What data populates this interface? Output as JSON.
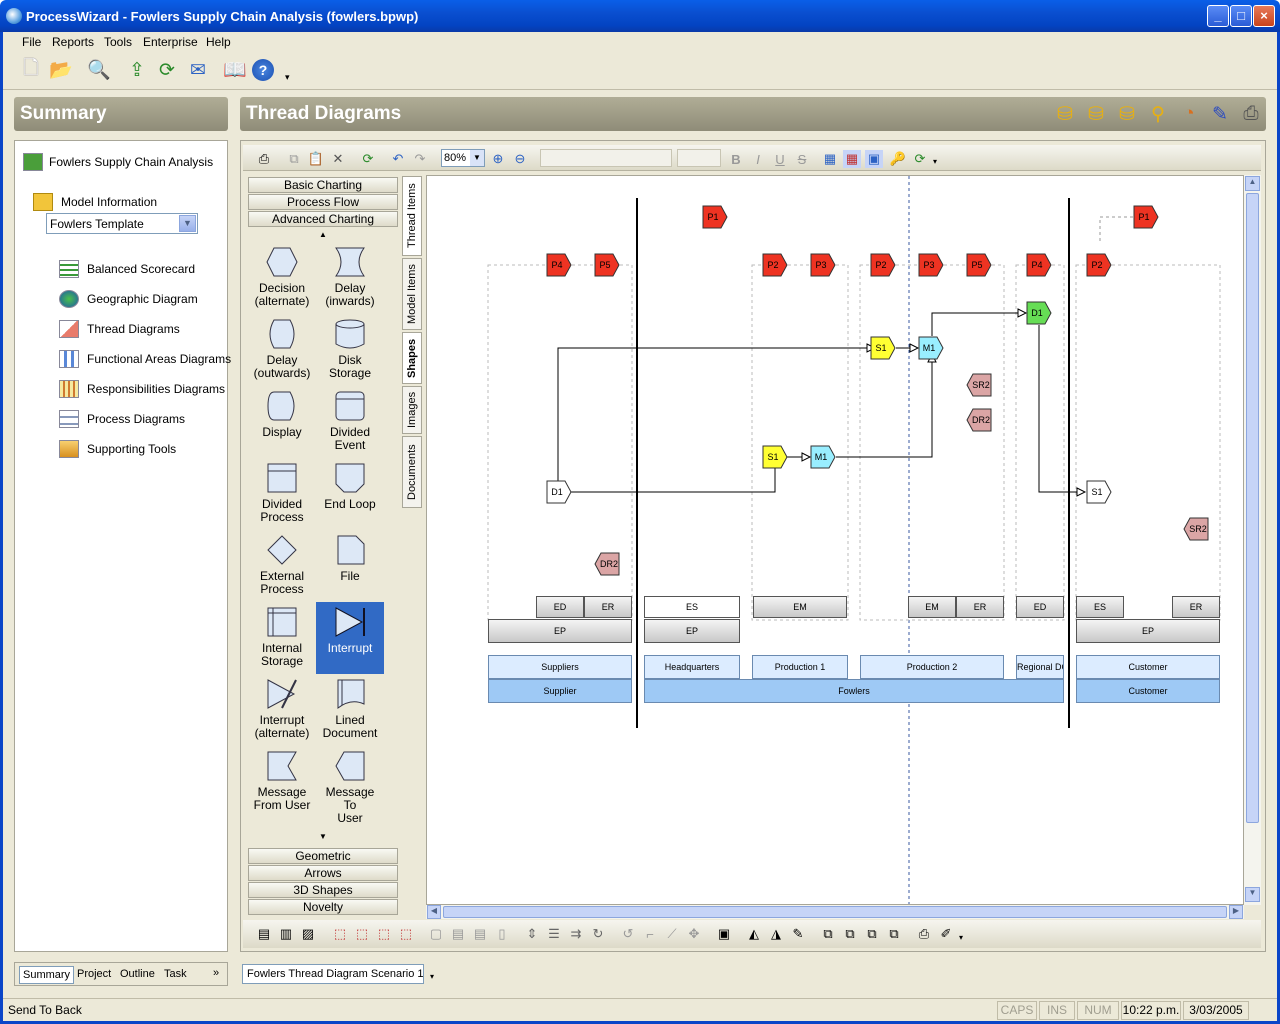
{
  "window": {
    "title": "ProcessWizard - Fowlers Supply Chain Analysis  (fowlers.bpwp)",
    "min": "_",
    "max": "□",
    "close": "×"
  },
  "menu": [
    "File",
    "Reports",
    "Tools",
    "Enterprise",
    "Help"
  ],
  "summary": {
    "header": "Summary",
    "root": "Fowlers Supply Chain Analysis",
    "model_info": "Model Information",
    "template": "Fowlers Template",
    "items": [
      "Balanced Scorecard",
      "Geographic Diagram",
      "Thread Diagrams",
      "Functional Areas Diagrams",
      "Responsibilities Diagrams",
      "Process Diagrams",
      "Supporting Tools"
    ]
  },
  "main": {
    "header": "Thread Diagrams"
  },
  "diagram_toolbar": {
    "zoom": "80%"
  },
  "palette": {
    "top_categories": [
      "Basic Charting",
      "Process Flow",
      "Advanced Charting"
    ],
    "shapes": [
      {
        "name": "decision-alternate",
        "label1": "Decision",
        "label2": "(alternate)"
      },
      {
        "name": "delay-inwards",
        "label1": "Delay",
        "label2": "(inwards)"
      },
      {
        "name": "delay-outwards",
        "label1": "Delay",
        "label2": "(outwards)"
      },
      {
        "name": "disk-storage",
        "label1": "Disk Storage",
        "label2": ""
      },
      {
        "name": "display",
        "label1": "Display",
        "label2": ""
      },
      {
        "name": "divided-event",
        "label1": "Divided",
        "label2": "Event"
      },
      {
        "name": "divided-process",
        "label1": "Divided",
        "label2": "Process"
      },
      {
        "name": "end-loop",
        "label1": "End Loop",
        "label2": ""
      },
      {
        "name": "external-process",
        "label1": "External",
        "label2": "Process"
      },
      {
        "name": "file",
        "label1": "File",
        "label2": ""
      },
      {
        "name": "internal-storage",
        "label1": "Internal",
        "label2": "Storage"
      },
      {
        "name": "interrupt",
        "label1": "Interrupt",
        "label2": ""
      },
      {
        "name": "interrupt-alternate",
        "label1": "Interrupt",
        "label2": "(alternate)"
      },
      {
        "name": "lined-document",
        "label1": "Lined",
        "label2": "Document"
      },
      {
        "name": "message-from-user",
        "label1": "Message",
        "label2": "From User"
      },
      {
        "name": "message-to-user",
        "label1": "Message To",
        "label2": "User"
      }
    ],
    "bottom_categories": [
      "Geometric",
      "Arrows",
      "3D Shapes",
      "Novelty"
    ],
    "side_tabs": [
      "Thread Items",
      "Model Items",
      "Shapes",
      "Images",
      "Documents"
    ]
  },
  "diagram": {
    "nodes": {
      "p1a": "P1",
      "p1b": "P1",
      "p4a": "P4",
      "p5a": "P5",
      "p2a": "P2",
      "p3a": "P3",
      "p2b": "P2",
      "p3b": "P3",
      "p5b": "P5",
      "p4b": "P4",
      "p2c": "P2",
      "s1a": "S1",
      "m1a": "M1",
      "s1b": "S1",
      "m1b": "M1",
      "d1a": "D1",
      "d1b": "D1",
      "s1c": "S1",
      "sr2a": "SR2",
      "dr2a": "DR2",
      "dr2b": "DR2",
      "sr2b": "SR2"
    },
    "bars": {
      "ed1": "ED",
      "er1": "ER",
      "ep1": "EP",
      "es2": "ES",
      "ep2": "EP",
      "em3": "EM",
      "em4": "EM",
      "er4": "ER",
      "ed5": "ED",
      "es6": "ES",
      "er6": "ER",
      "ep6": "EP"
    },
    "units": {
      "u1": "Suppliers",
      "u2": "Headquarters",
      "u3": "Production 1",
      "u4": "Production 2",
      "u5": "Regional DC",
      "u6": "Customer"
    },
    "entities": {
      "e1": "Supplier",
      "e2": "Fowlers",
      "e3": "Customer"
    }
  },
  "nav_tabs": [
    "Summary",
    "Project",
    "Outline",
    "Task"
  ],
  "doc_tab": "Fowlers Thread Diagram Scenario 1",
  "status": {
    "message": "Send To Back",
    "caps": "CAPS",
    "ins": "INS",
    "num": "NUM",
    "time": "10:22 p.m.",
    "date": "3/03/2005"
  },
  "colors": {
    "red": "#ee3322",
    "yellow": "#ffff33",
    "cyan": "#99eeff",
    "green": "#66dd55",
    "pink": "#dba5a5",
    "accent": "#316ac5"
  }
}
